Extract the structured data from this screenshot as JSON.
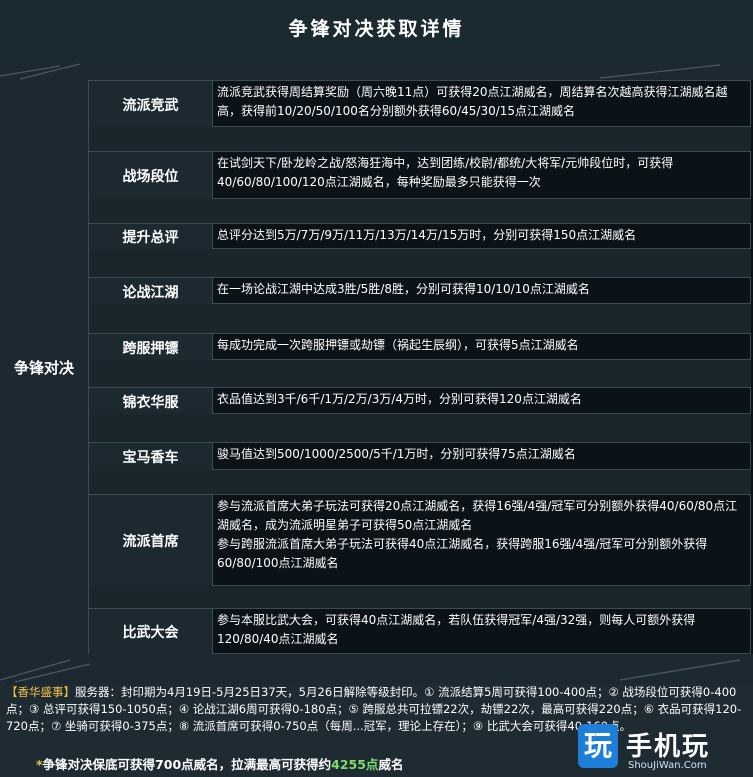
{
  "title": "争锋对决获取详情",
  "category": "争锋对决",
  "rows": [
    {
      "name": "流派竞武",
      "desc": "流派竞武获得周结算奖励（周六晚11点）可获得20点江湖威名，周结算名次越高获得江湖威名越高，获得前10/20/50/100名分别额外获得60/45/30/15点江湖威名"
    },
    {
      "name": "战场段位",
      "desc": "在试剑天下/卧龙岭之战/怒海狂海中，达到团练/校尉/都统/大将军/元帅段位时，可获得40/60/80/100/120点江湖威名，每种奖励最多只能获得一次"
    },
    {
      "name": "提升总评",
      "desc": "总评分达到5万/7万/9万/11万/13万/14万/15万时，分别可获得150点江湖威名"
    },
    {
      "name": "论战江湖",
      "desc": "在一场论战江湖中达成3胜/5胜/8胜，分别可获得10/10/10点江湖威名"
    },
    {
      "name": "跨服押镖",
      "desc": "每成功完成一次跨服押镖或劫镖（祸起生辰纲），可获得5点江湖威名"
    },
    {
      "name": "锦衣华服",
      "desc": "衣品值达到3千/6千/1万/2万/3万/4万时，分别可获得120点江湖威名"
    },
    {
      "name": "宝马香车",
      "desc": "骏马值达到500/1000/2500/5千/1万时，分别可获得75点江湖威名"
    },
    {
      "name": "流派首席",
      "desc": "参与流派首席大弟子玩法可获得20点江湖威名，获得16强/4强/冠军可分别额外获得40/60/80点江湖威名，成为流派明星弟子可获得50点江湖威名\n参与跨服流派首席大弟子玩法可获得40点江湖威名，获得跨服16强/4强/冠军可分别额外获得60/80/100点江湖威名"
    },
    {
      "name": "比武大会",
      "desc": "参与本服比武大会，可获得40点江湖威名，若队伍获得冠军/4强/32强，则每人可额外获得120/80/40点江湖威名"
    }
  ],
  "notes": {
    "head": "【香华盛事】",
    "body": "服务器：封印期为4月19日-5月25日37天，5月26日解除等级封印。① 流派结算5周可获得100-400点；② 战场段位可获得0-400点；③ 总评可获得150-1050点；④ 论战江湖6周可获得0-180点；⑤ 跨服总共可拉镖22次，劫镖22次，最高可获得220点；⑥ 衣品可获得120-720点；⑦ 坐骑可获得0-375点；⑧ 流派首席可获得0-750点（每周...冠军，理论上存在）；⑨ 比武大会可获得40-160点。",
    "summary_prefix": "争锋对决保底可获得700点威名，拉满最高可获得约",
    "summary_num": "4255点",
    "summary_suffix": "威名"
  },
  "logo": {
    "text1": "玩",
    "text2": "手机玩",
    "url": "ShouJiWan.Com"
  },
  "colors": {
    "accent": "#f0c048",
    "green": "#7ddc6a"
  }
}
